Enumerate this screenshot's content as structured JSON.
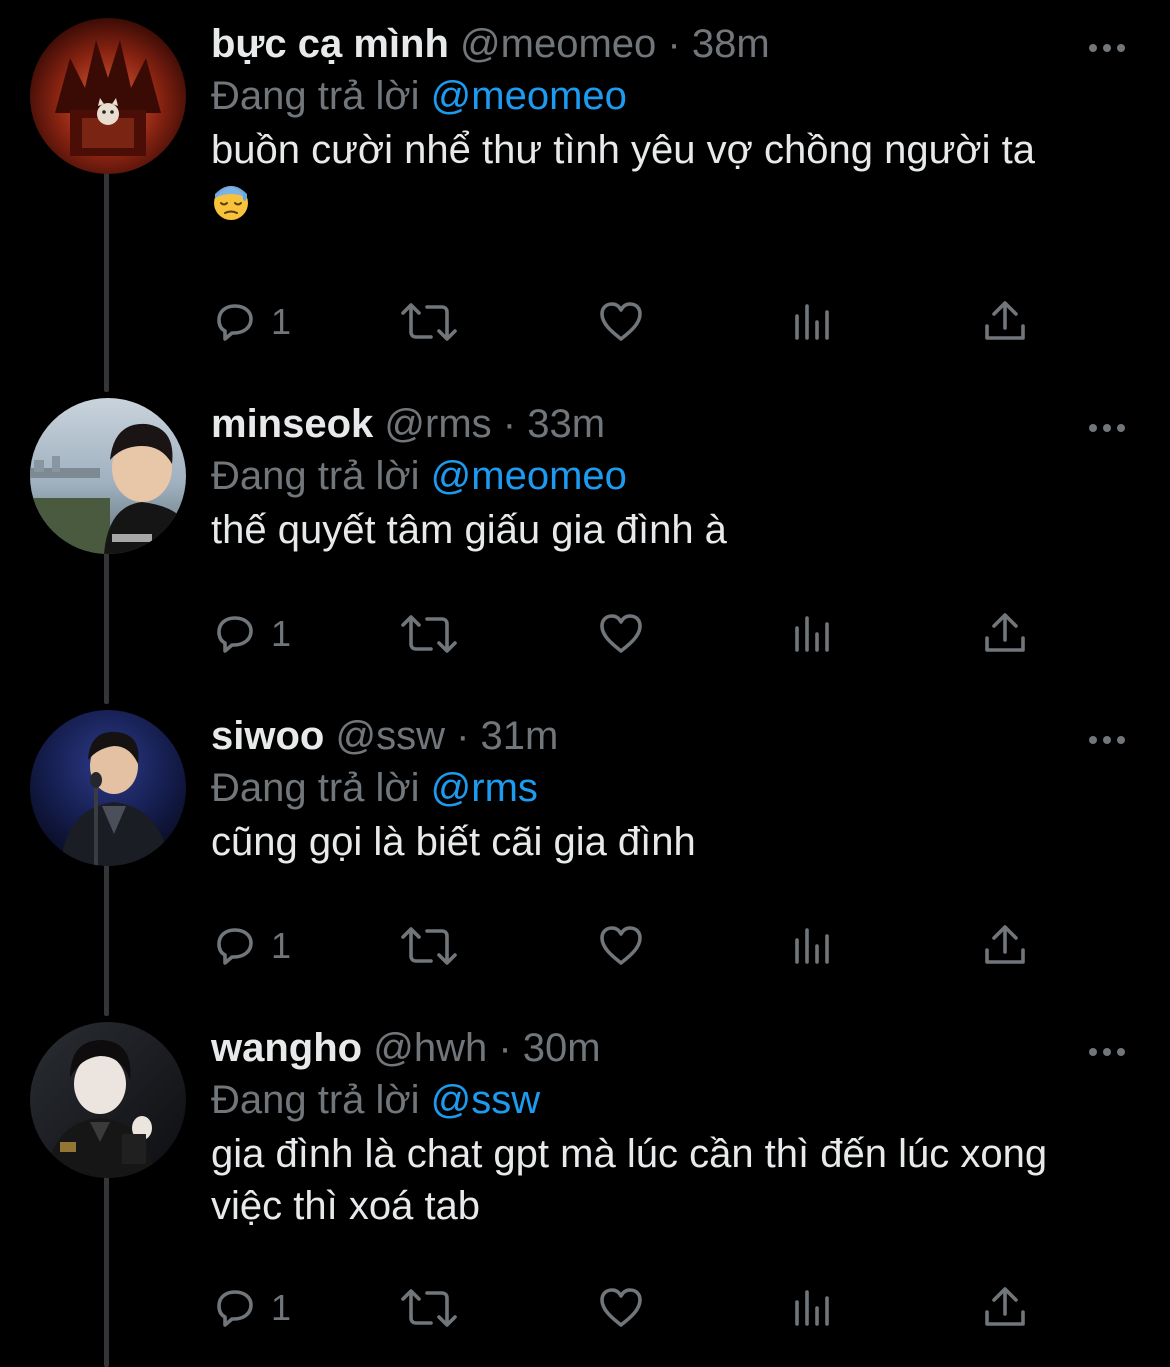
{
  "reply_label": "Đang trả lời",
  "tweets": [
    {
      "name": "bực cạ mình",
      "handle": "@meomeo",
      "separator": "·",
      "time": "38m",
      "reply_to": "@meomeo",
      "text": "buồn cười nhể thư tình yêu vợ chồng người ta",
      "emoji": "downcast-face-with-sweat",
      "reply_count": "1"
    },
    {
      "name": "minseok",
      "handle": "@rms",
      "separator": "·",
      "time": "33m",
      "reply_to": "@meomeo",
      "text": "thế quyết tâm giấu gia đình à",
      "reply_count": "1"
    },
    {
      "name": "siwoo",
      "handle": "@ssw",
      "separator": "·",
      "time": "31m",
      "reply_to": "@rms",
      "text": "cũng gọi là biết cãi gia đình",
      "reply_count": "1"
    },
    {
      "name": "wangho",
      "handle": "@hwh",
      "separator": "·",
      "time": "30m",
      "reply_to": "@ssw",
      "text": "gia đình là chat gpt mà lúc cần thì đến lúc xong việc thì xoá tab",
      "reply_count": "1"
    }
  ],
  "colors": {
    "background": "#000000",
    "text_primary": "#e7e9ea",
    "text_secondary": "#71767b",
    "accent": "#1d9bf0",
    "thread_line": "#333639"
  },
  "icons": [
    "more-icon",
    "reply-icon",
    "retweet-icon",
    "like-icon",
    "views-icon",
    "share-icon"
  ]
}
